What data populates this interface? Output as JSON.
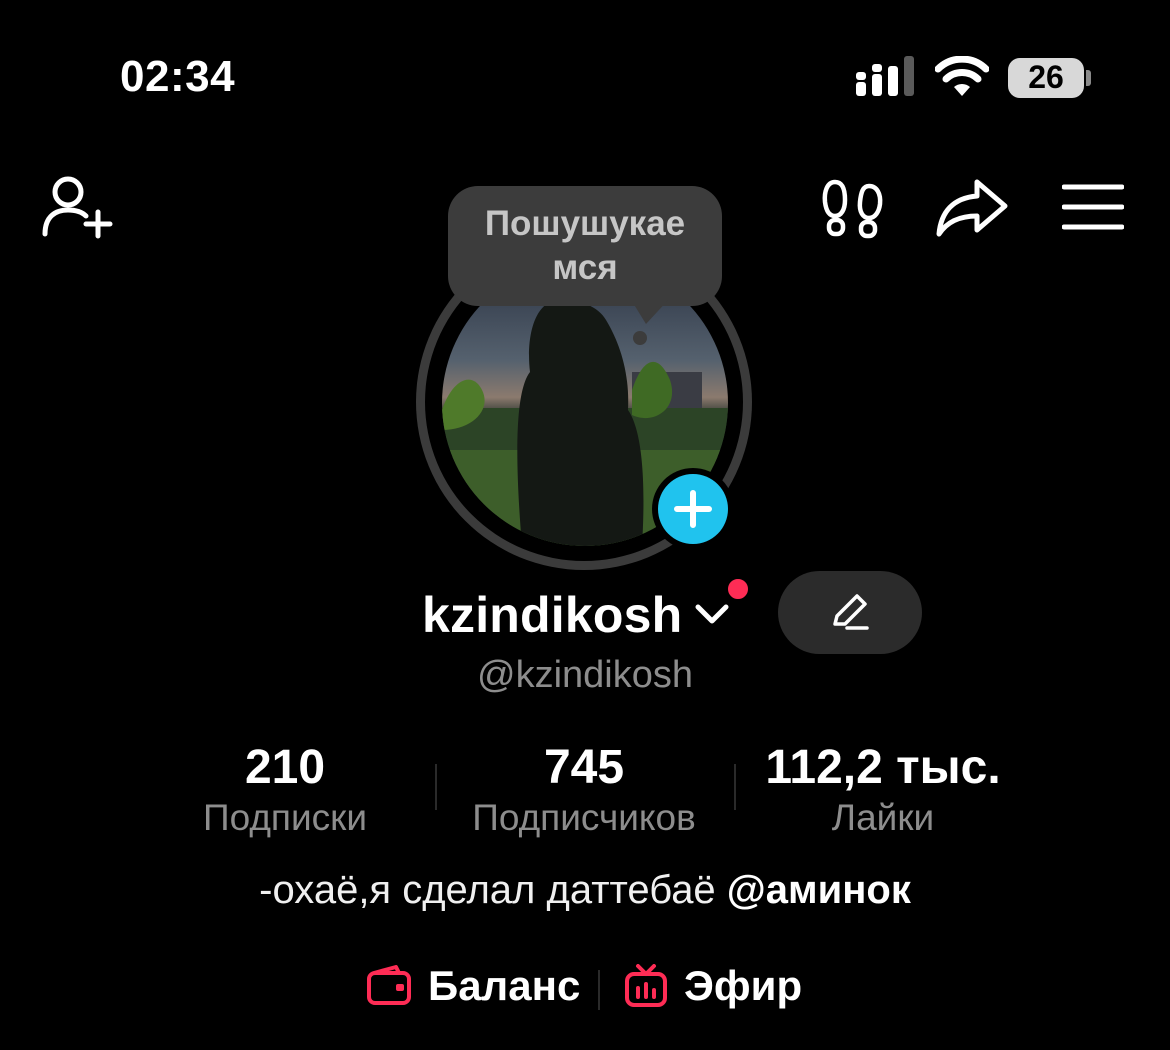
{
  "status_bar": {
    "time": "02:34",
    "battery": "26"
  },
  "note": {
    "text_line1": "Пошушукае",
    "text_line2": "мся"
  },
  "profile": {
    "username": "kzindikosh",
    "handle": "@kzindikosh"
  },
  "stats": [
    {
      "value": "210",
      "label": "Подписки"
    },
    {
      "value": "745",
      "label": "Подписчиков"
    },
    {
      "value": "112,2 тыс.",
      "label": "Лайки"
    }
  ],
  "bio": {
    "text": "-охаё,я сделал даттебаё ",
    "mention": "@аминок"
  },
  "links": {
    "balance": "Баланс",
    "live": "Эфир"
  },
  "colors": {
    "accent_red": "#fe2c55",
    "add_blue": "#20c3ee",
    "background": "#000000"
  }
}
